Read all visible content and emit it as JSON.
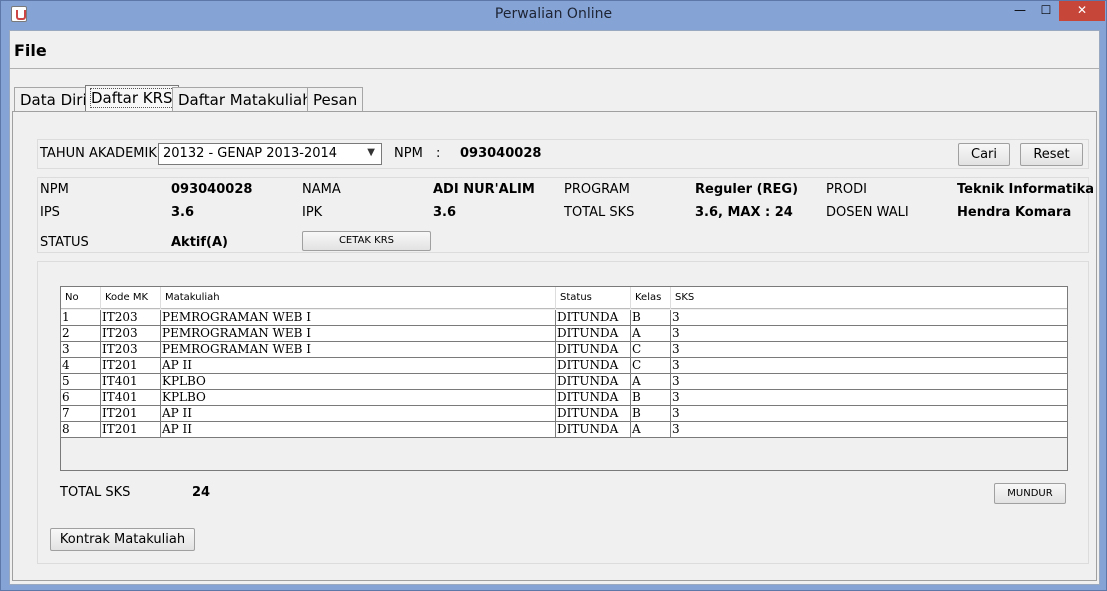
{
  "window": {
    "title": "Perwalian Online",
    "minimize": "—",
    "maximize": "☐",
    "close": "✕"
  },
  "menu": {
    "file": "File"
  },
  "tabs": [
    {
      "label": "Data Diri"
    },
    {
      "label": "Daftar KRS"
    },
    {
      "label": "Daftar Matakuliah"
    },
    {
      "label": "Pesan"
    }
  ],
  "filter": {
    "tahun_label": "TAHUN AKADEMIK",
    "tahun_value": "20132 - GENAP  2013-2014",
    "npm_label": "NPM",
    "colon": ":",
    "npm_value": "093040028",
    "cari": "Cari",
    "reset": "Reset"
  },
  "info": {
    "npm_label": "NPM",
    "npm_value": "093040028",
    "nama_label": "NAMA",
    "nama_value": "ADI NUR'ALIM",
    "program_label": "PROGRAM",
    "program_value": "Reguler (REG)",
    "prodi_label": "PRODI",
    "prodi_value": "Teknik Informatika",
    "ips_label": "IPS",
    "ips_value": "3.6",
    "ipk_label": "IPK",
    "ipk_value": "3.6",
    "total_sks_label": "TOTAL SKS",
    "total_sks_value": "3.6, MAX : 24",
    "dosen_label": "DOSEN WALI",
    "dosen_value": "Hendra Komara",
    "status_label": "STATUS",
    "status_value": "Aktif(A)",
    "cetak": "CETAK KRS"
  },
  "table": {
    "headers": [
      "No",
      "Kode MK",
      "Matakuliah",
      "Status",
      "Kelas",
      "SKS"
    ],
    "rows": [
      [
        "1",
        "IT203",
        "PEMROGRAMAN WEB I",
        "DITUNDA",
        "B",
        "3"
      ],
      [
        "2",
        "IT203",
        "PEMROGRAMAN WEB I",
        "DITUNDA",
        "A",
        "3"
      ],
      [
        "3",
        "IT203",
        "PEMROGRAMAN WEB I",
        "DITUNDA",
        "C",
        "3"
      ],
      [
        "4",
        "IT201",
        "AP II",
        "DITUNDA",
        "C",
        "3"
      ],
      [
        "5",
        "IT401",
        "KPLBO",
        "DITUNDA",
        "A",
        "3"
      ],
      [
        "6",
        "IT401",
        "KPLBO",
        "DITUNDA",
        "B",
        "3"
      ],
      [
        "7",
        "IT201",
        "AP II",
        "DITUNDA",
        "B",
        "3"
      ],
      [
        "8",
        "IT201",
        "AP II",
        "DITUNDA",
        "A",
        "3"
      ]
    ]
  },
  "footer": {
    "total_sks_label": "TOTAL SKS",
    "total_sks_value": "24",
    "mundur": "MUNDUR",
    "kontrak": "Kontrak Matakuliah"
  }
}
